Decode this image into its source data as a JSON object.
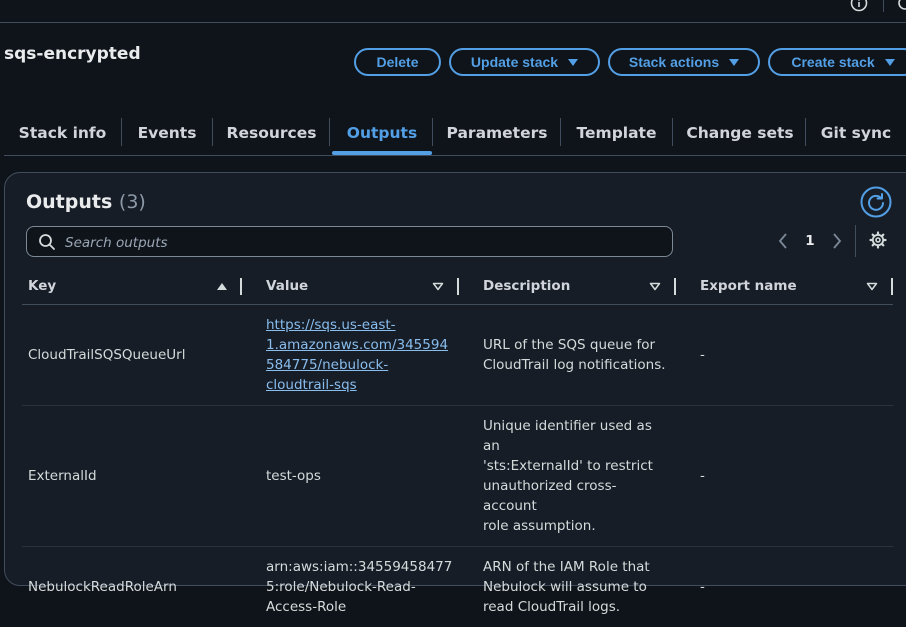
{
  "topbar": {
    "info_icon": "info-icon",
    "settings_icon": "settings-icon"
  },
  "stack": {
    "name": "sqs-encrypted"
  },
  "actions": {
    "delete": "Delete",
    "update_stack": "Update stack",
    "stack_actions": "Stack actions",
    "create_stack": "Create stack"
  },
  "tabs": [
    {
      "label": "Stack info"
    },
    {
      "label": "Events"
    },
    {
      "label": "Resources"
    },
    {
      "label": "Outputs",
      "active": true
    },
    {
      "label": "Parameters"
    },
    {
      "label": "Template"
    },
    {
      "label": "Change sets"
    },
    {
      "label": "Git sync"
    }
  ],
  "outputs": {
    "title": "Outputs",
    "count": "(3)",
    "search_placeholder": "Search outputs",
    "page": "1",
    "columns": {
      "key": "Key",
      "value": "Value",
      "description": "Description",
      "export_name": "Export name"
    },
    "rows": [
      {
        "key": "CloudTrailSQSQueueUrl",
        "value_lines": [
          "https://sqs.us-east-",
          "1.amazonaws.com/345594",
          "584775/nebulock-",
          "cloudtrail-sqs"
        ],
        "value_is_link": true,
        "description_lines": [
          "URL of the SQS queue for",
          "CloudTrail log notifications."
        ],
        "export_name": "-"
      },
      {
        "key": "ExternalId",
        "value_lines": [
          "test-ops"
        ],
        "value_is_link": false,
        "description_lines": [
          "Unique identifier used as an",
          "'sts:ExternalId' to restrict",
          "unauthorized cross-account",
          "role assumption."
        ],
        "export_name": "-"
      },
      {
        "key": "NebulockReadRoleArn",
        "value_lines": [
          "arn:aws:iam::34559458477",
          "5:role/Nebulock-Read-",
          "Access-Role"
        ],
        "value_is_link": false,
        "description_lines": [
          "ARN of the IAM Role that",
          "Nebulock will assume to",
          "read CloudTrail logs."
        ],
        "export_name": "-"
      }
    ]
  },
  "colors": {
    "accent": "#539fe5",
    "link": "#89bdee",
    "background": "#0f141a",
    "panel": "#161d26"
  }
}
